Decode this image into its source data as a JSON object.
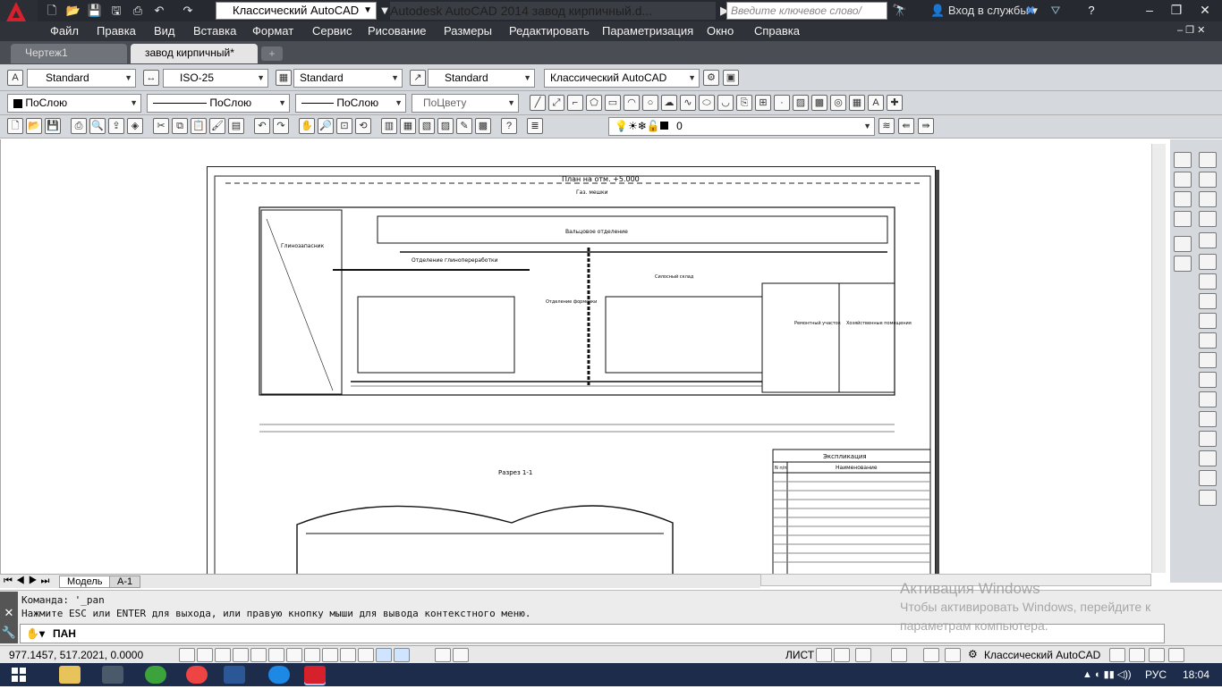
{
  "titlebar": {
    "workspace": "Классический AutoCAD",
    "title": "Autodesk AutoCAD 2014    завод кирпичный.d...",
    "search_placeholder": "Введите ключевое слово/фразу",
    "login": "Вход в службы"
  },
  "menu": [
    "Файл",
    "Правка",
    "Вид",
    "Вставка",
    "Формат",
    "Сервис",
    "Рисование",
    "Размеры",
    "Редактировать",
    "Параметризация",
    "Окно",
    "Справка"
  ],
  "tabs": [
    "Чертеж1",
    "завод кирпичный*"
  ],
  "styles": {
    "text_style": "Standard",
    "dim_style": "ISO-25",
    "table_style": "Standard",
    "mleader_style": "Standard",
    "workspace": "Классический AutoCAD"
  },
  "properties": {
    "color": "ПоСлою",
    "linetype": "ПоСлою",
    "lineweight": "ПоСлою",
    "plotstyle": "ПоЦвету"
  },
  "layer": {
    "name": "0"
  },
  "drawing": {
    "plan_title": "План на отм. +5.000",
    "section_title": "Разрез 1-1",
    "explication_title": "Экспликация",
    "explication_header": [
      "N п/п",
      "Наименование"
    ],
    "labels": [
      "Глинозапасник",
      "Отделение глинопереработки",
      "Вальцовое отделение",
      "Отделение формовки",
      "Ремонтный участок",
      "Хозяйственные помещения",
      "Силосный склад",
      "Газ. мешки"
    ]
  },
  "layout_tabs": [
    "Модель",
    "A-1"
  ],
  "command": {
    "line1": "Команда:  '_pan",
    "line2": "Нажмите ESC или ENTER для выхода, или правую кнопку мыши для вывода контекстного меню.",
    "input": "ПАН"
  },
  "status": {
    "coords": "977.1457,  517.2021, 0.0000",
    "paper": "ЛИСТ",
    "workspace": "Классический AutoCAD"
  },
  "watermark": {
    "line1": "Активация Windows",
    "line2": "Чтобы активировать Windows, перейдите к",
    "line3": "параметрам компьютера."
  },
  "tray": {
    "lang": "РУС",
    "time": "18:04"
  }
}
